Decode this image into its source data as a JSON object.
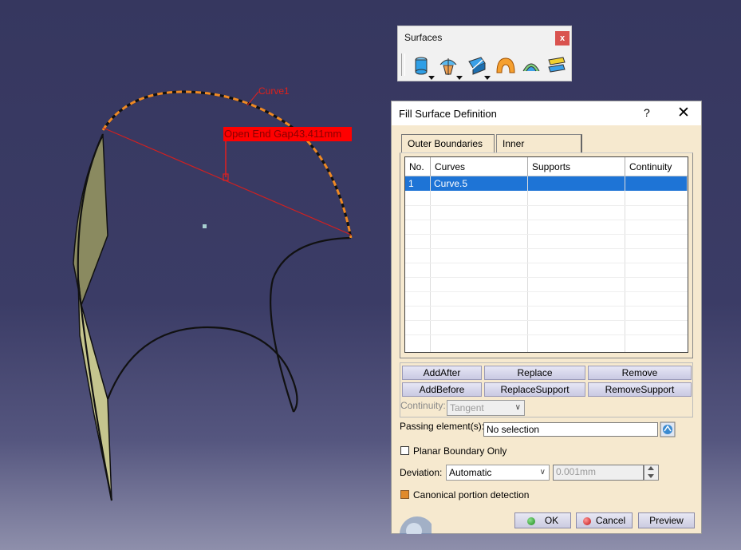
{
  "viewport": {
    "curve_label": "Curve1",
    "gap_label": "Open End Gap43.411mm"
  },
  "toolbar": {
    "title": "Surfaces",
    "close": "x",
    "icons": [
      "extrude-icon",
      "revolve-icon",
      "sweep-icon",
      "fill-icon",
      "multi-section-icon",
      "blend-icon"
    ]
  },
  "dialog": {
    "title": "Fill Surface Definition",
    "help": "?",
    "close": "✕",
    "tabs": [
      "Outer Boundaries",
      "Inner Boundaries"
    ],
    "columns": [
      "No.",
      "Curves",
      "Supports",
      "Continuity"
    ],
    "rows": [
      {
        "no": "1",
        "curves": "Curve.5",
        "supports": "",
        "continuity": ""
      }
    ],
    "buttons": {
      "add_after": "AddAfter",
      "replace": "Replace",
      "remove": "Remove",
      "add_before": "AddBefore",
      "replace_support": "ReplaceSupport",
      "remove_support": "RemoveSupport"
    },
    "continuity_label": "Continuity:",
    "continuity_value": "Tangent",
    "passing_label": "Passing element(s):",
    "passing_value": "No selection",
    "planar_label": "Planar Boundary Only",
    "planar_checked": false,
    "deviation_label": "Deviation:",
    "deviation_mode": "Automatic",
    "deviation_value": "0.001mm",
    "canonical_label": "Canonical portion detection",
    "canonical_checked": true,
    "ok": "OK",
    "cancel": "Cancel",
    "preview": "Preview"
  }
}
